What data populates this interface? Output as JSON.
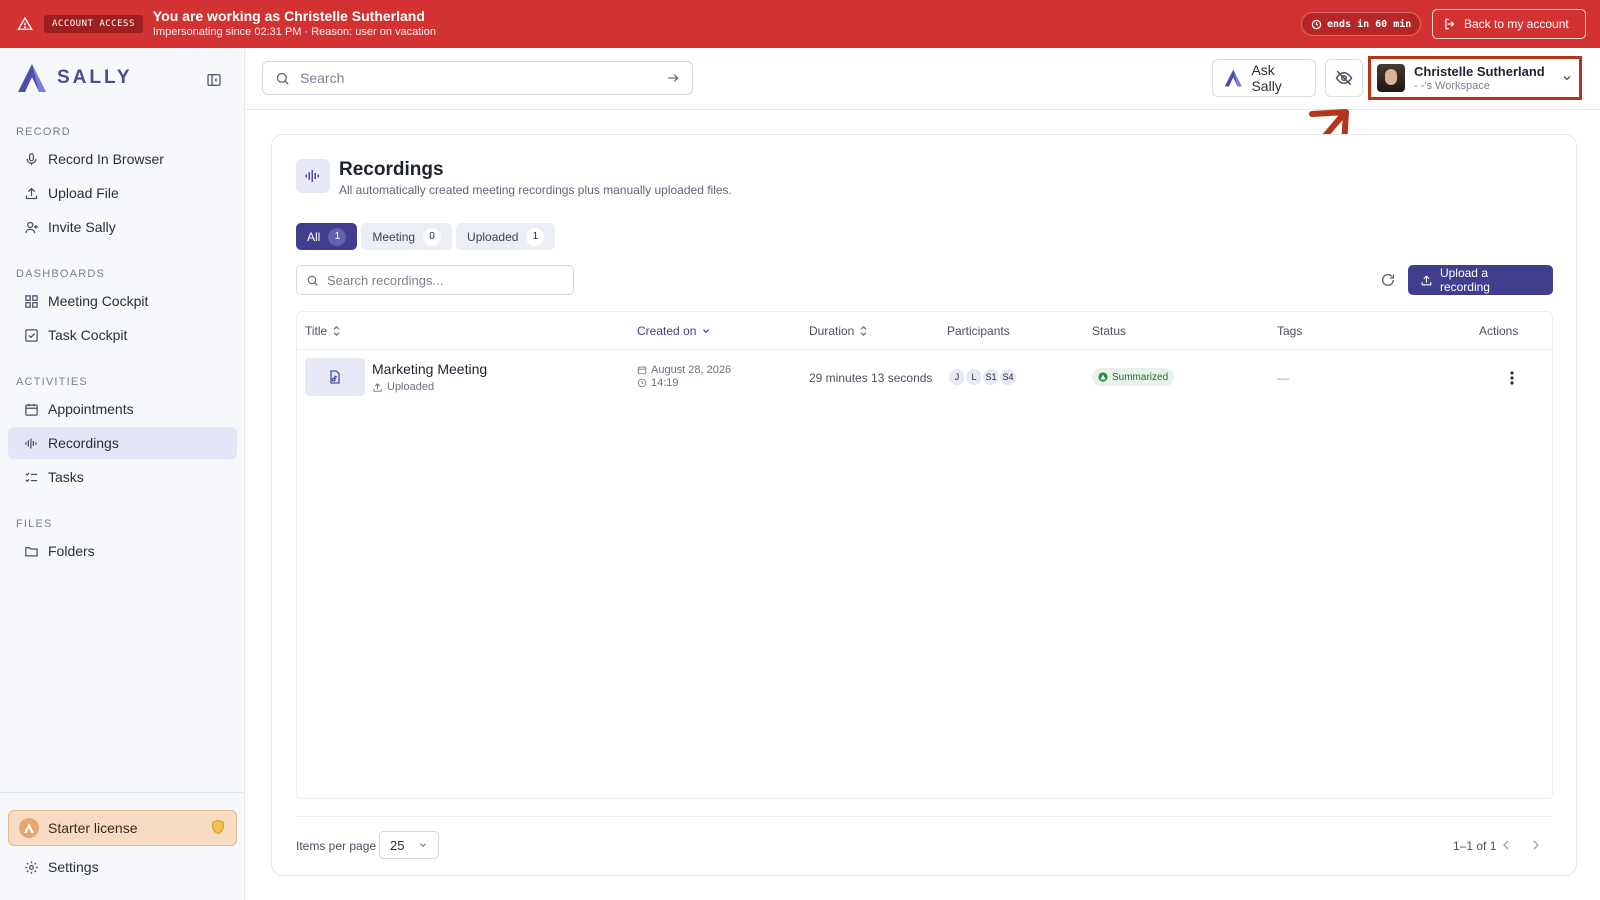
{
  "banner": {
    "badge": "ACCOUNT ACCESS",
    "title": "You are working as Christelle Sutherland",
    "subtitle": "Impersonating since 02:31 PM · Reason: user on vacation",
    "timer": "ends in 60 min",
    "back_label": "Back to my account"
  },
  "app": {
    "name": "SALLY"
  },
  "sidebar": {
    "sections": [
      {
        "label": "RECORD",
        "items": [
          "Record In Browser",
          "Upload File",
          "Invite Sally"
        ]
      },
      {
        "label": "DASHBOARDS",
        "items": [
          "Meeting Cockpit",
          "Task Cockpit"
        ]
      },
      {
        "label": "ACTIVITIES",
        "items": [
          "Appointments",
          "Recordings",
          "Tasks"
        ]
      },
      {
        "label": "FILES",
        "items": [
          "Folders"
        ]
      }
    ],
    "active_item": "Recordings",
    "license": "Starter license",
    "settings": "Settings"
  },
  "topbar": {
    "search_placeholder": "Search",
    "ask_label": "Ask Sally",
    "user_name": "Christelle Sutherland",
    "workspace": "- -'s Workspace"
  },
  "page": {
    "title": "Recordings",
    "subtitle": "All automatically created meeting recordings plus manually uploaded files.",
    "filters": [
      {
        "label": "All",
        "count": "1",
        "active": true
      },
      {
        "label": "Meeting",
        "count": "0",
        "active": false
      },
      {
        "label": "Uploaded",
        "count": "1",
        "active": false
      }
    ],
    "search_placeholder": "Search recordings...",
    "upload_label": "Upload a recording"
  },
  "table": {
    "columns": [
      "Title",
      "Created on",
      "Duration",
      "Participants",
      "Status",
      "Tags",
      "Actions"
    ],
    "rows": [
      {
        "title": "Marketing Meeting",
        "source": "Uploaded",
        "date": "August 28, 2026",
        "time": "14:19",
        "duration": "29 minutes 13 seconds",
        "participants": [
          "J",
          "L",
          "S1",
          "S4"
        ],
        "status": "Summarized",
        "tags": "—"
      }
    ]
  },
  "footer": {
    "items_per_page_label": "Items per page",
    "items_per_page": "25",
    "range": "1–1 of 1"
  },
  "colors": {
    "banner": "#d33232",
    "primary": "#413e8e",
    "annotation": "#b5341c",
    "status_green": "#256b35"
  }
}
